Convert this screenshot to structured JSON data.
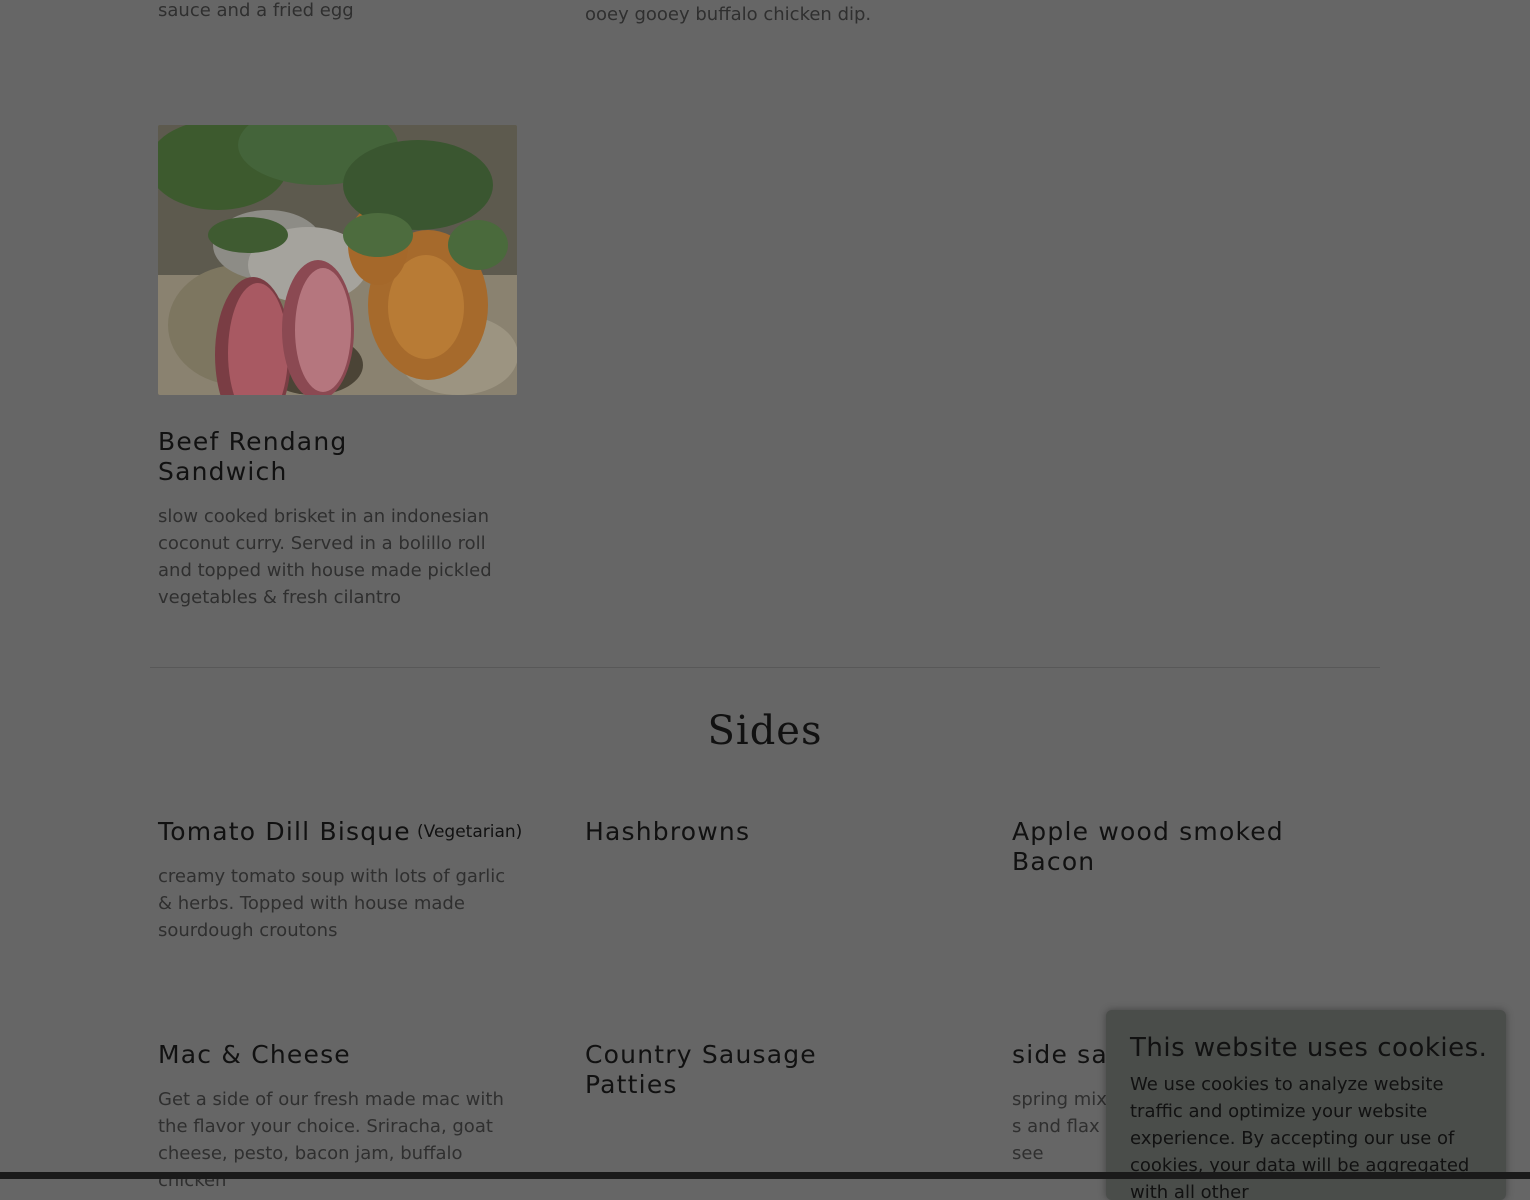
{
  "top": {
    "left_desc_tail": "sauce and a fried egg",
    "middle_desc_tail": "ooey gooey buffalo chicken dip."
  },
  "sandwich": {
    "title": "Beef Rendang Sandwich",
    "description": "slow cooked brisket in an indonesian coconut curry. Served in a bolillo roll and topped with house made pickled vegetables & fresh cilantro"
  },
  "sides": {
    "heading": "Sides",
    "items": [
      {
        "title": "Tomato Dill Bisque",
        "tag": "(Vegetarian)",
        "description": "creamy tomato soup with lots of garlic & herbs.  Topped with house made sourdough croutons"
      },
      {
        "title": "Hashbrowns"
      },
      {
        "title": "Apple wood smoked Bacon"
      },
      {
        "title": "Mac & Cheese",
        "description": "Get a side of our fresh made mac with the flavor your choice. Sriracha, goat cheese, pesto, bacon jam, buffalo chicken"
      },
      {
        "title": "Country Sausage Patties"
      },
      {
        "title": "side sala",
        "description": "spring mix s and flax see"
      }
    ]
  },
  "cookie_banner": {
    "title": "This website uses cookies.",
    "body": "We use cookies to analyze website traffic and optimize your website experience. By accepting our use of cookies, your data will be aggregated with all other"
  }
}
